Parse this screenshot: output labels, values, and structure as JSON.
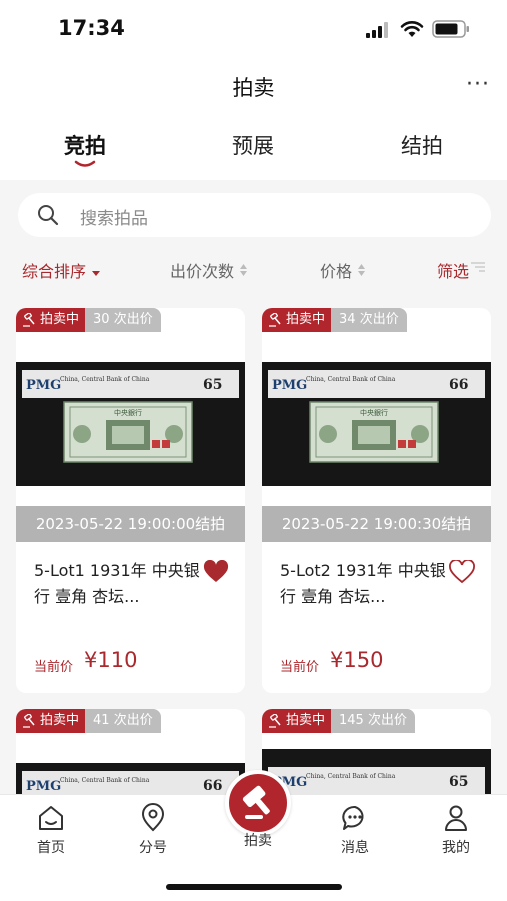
{
  "status": {
    "time": "17:34"
  },
  "header": {
    "title": "拍卖",
    "more": "···"
  },
  "tabs": [
    {
      "label": "竞拍"
    },
    {
      "label": "预展"
    },
    {
      "label": "结拍"
    }
  ],
  "search": {
    "placeholder": "搜索拍品"
  },
  "sort": {
    "comprehensive": "综合排序",
    "bids": "出价次数",
    "price": "价格",
    "filter": "筛选"
  },
  "colors": {
    "accent": "#b1262d",
    "price": "#a8292e"
  },
  "lots": [
    {
      "status": "拍卖中",
      "bids": "30 次出价",
      "note_header": "China, Central Bank of China",
      "note_grade": "65",
      "note_name": "中央銀行",
      "end_time": "2023-05-22 19:00:00结拍",
      "title": "5-Lot1 1931年 中央银行 壹角 杏坛...",
      "liked": true,
      "price_label": "当前价",
      "price": "¥110"
    },
    {
      "status": "拍卖中",
      "bids": "34 次出价",
      "note_header": "China, Central Bank of China",
      "note_grade": "66",
      "note_name": "中央銀行",
      "end_time": "2023-05-22 19:00:30结拍",
      "title": "5-Lot2 1931年 中央银行 壹角 杏坛...",
      "liked": false,
      "price_label": "当前价",
      "price": "¥150"
    },
    {
      "status": "拍卖中",
      "bids": "41 次出价",
      "note_header": "China, Central Bank of China",
      "note_grade": "66"
    },
    {
      "status": "拍卖中",
      "bids": "145 次出价",
      "note_header": "China, Central Bank of China",
      "note_grade": "65"
    }
  ],
  "bottom_nav": [
    {
      "label": "首页",
      "icon": "home-icon"
    },
    {
      "label": "分号",
      "icon": "location-icon"
    },
    {
      "label": "拍卖",
      "icon": "gavel-icon"
    },
    {
      "label": "消息",
      "icon": "message-icon"
    },
    {
      "label": "我的",
      "icon": "profile-icon"
    }
  ]
}
